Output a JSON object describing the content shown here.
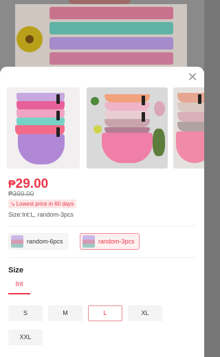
{
  "product": {
    "currency_symbol": "₱",
    "price": "29.00",
    "original_price": "₱399.00",
    "lowest_price_badge": "Lowest price in 60 days",
    "selected_summary": "Size:Int:L, random-3pcs"
  },
  "variants": [
    {
      "label": "random-6pcs",
      "selected": false
    },
    {
      "label": "random-3pcs",
      "selected": true
    }
  ],
  "size_section": {
    "title": "Size",
    "tab_label": "Int",
    "sizes": [
      {
        "label": "S",
        "selected": false
      },
      {
        "label": "M",
        "selected": false
      },
      {
        "label": "L",
        "selected": true
      },
      {
        "label": "XL",
        "selected": false
      },
      {
        "label": "XXL",
        "selected": false
      }
    ]
  },
  "colors": {
    "accent": "#e8364a",
    "accent_bg": "#fde6e7"
  },
  "icons": {
    "close": "close-icon",
    "lowest_price": "trend-down-icon"
  }
}
